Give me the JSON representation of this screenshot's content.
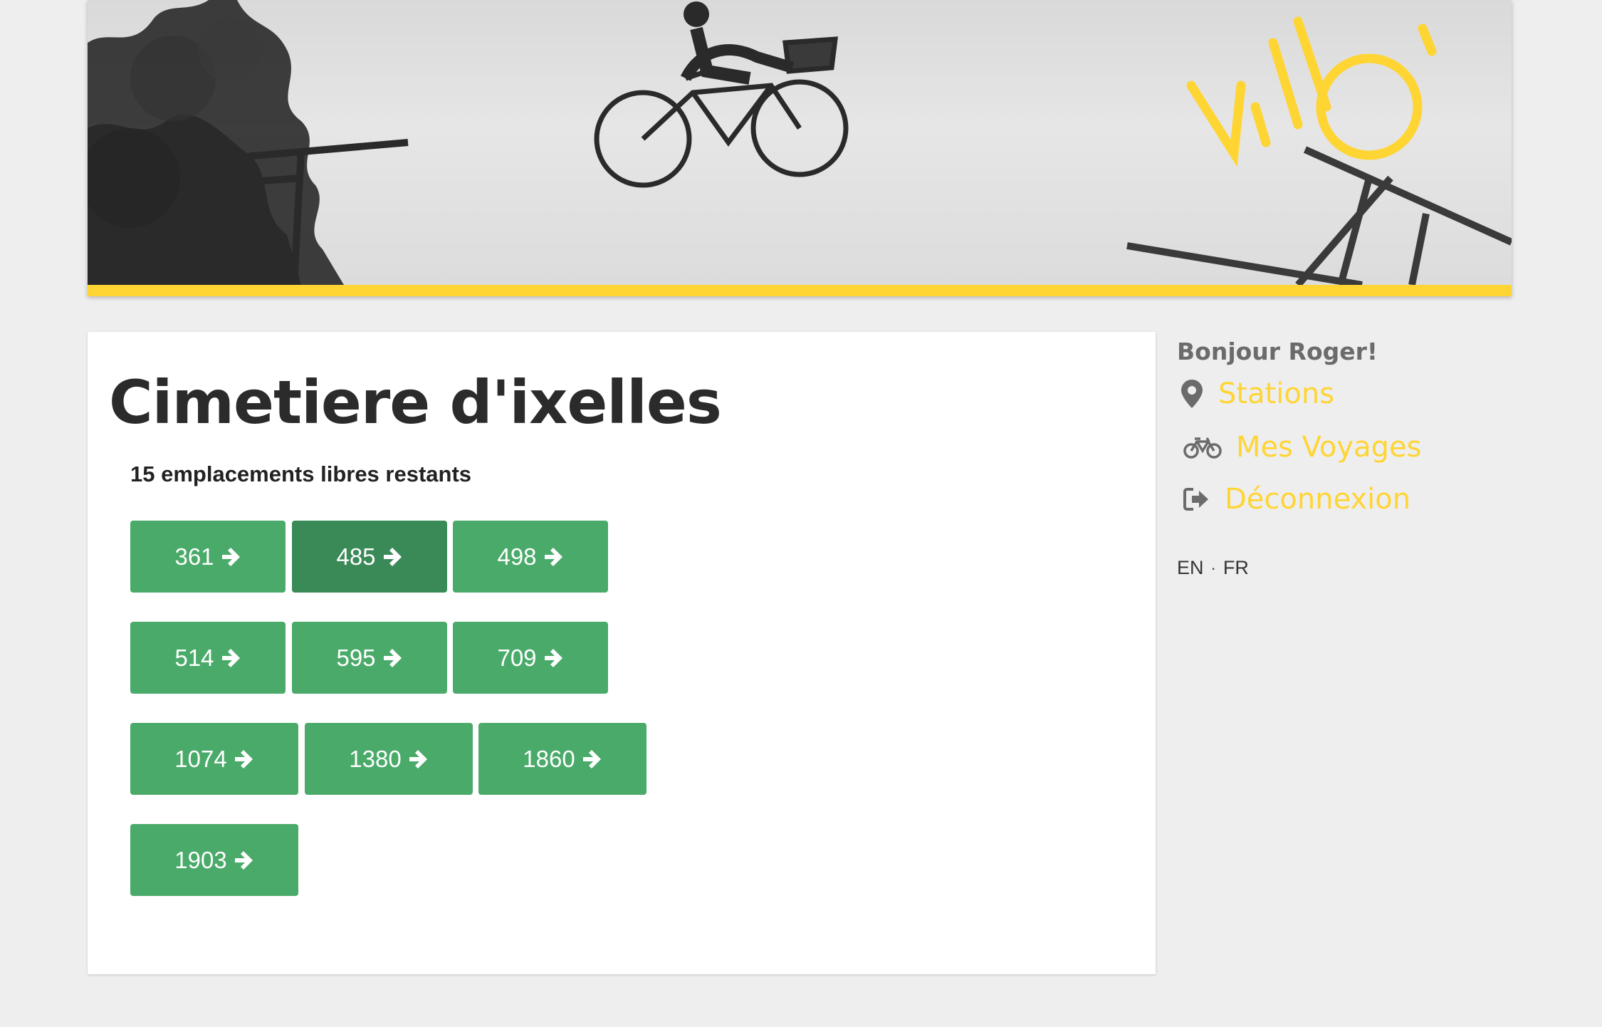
{
  "banner": {
    "logo_text": "Villo!",
    "accent_color": "#ffd534"
  },
  "station": {
    "title": "Cimetiere d'ixelles",
    "free_slots_text": "15 emplacements libres restants"
  },
  "slots": [
    {
      "label": "361"
    },
    {
      "label": "485",
      "active": true
    },
    {
      "label": "498"
    },
    {
      "label": "514"
    },
    {
      "label": "595"
    },
    {
      "label": "709"
    },
    {
      "label": "1074"
    },
    {
      "label": "1380"
    },
    {
      "label": "1860"
    },
    {
      "label": "1903"
    }
  ],
  "slot_icon": "arrow-right-icon",
  "sidebar": {
    "greeting": "Bonjour Roger!",
    "nav": [
      {
        "label": "Stations",
        "icon": "map-marker-icon"
      },
      {
        "label": "Mes Voyages",
        "icon": "bicycle-icon"
      },
      {
        "label": "Déconnexion",
        "icon": "sign-out-icon"
      }
    ],
    "languages": [
      "EN",
      "FR"
    ],
    "separator": "·"
  },
  "colors": {
    "button_green": "#4aaa6a",
    "button_green_active": "#3a8a58",
    "link_yellow": "#ffd534",
    "background": "#eeeeee"
  }
}
